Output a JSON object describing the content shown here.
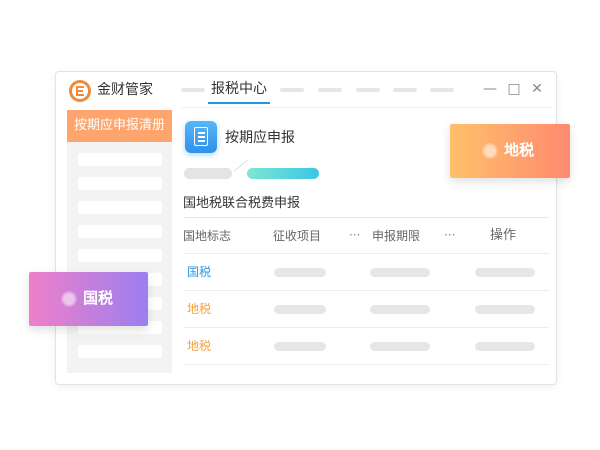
{
  "window": {
    "app_title": "金财管家",
    "active_tab": "报税中心",
    "controls": {
      "minimize": "—",
      "maximize": "□",
      "close": "✕"
    }
  },
  "sidebar": {
    "header_label": "按期应申报清册",
    "header_color": "#fda56c"
  },
  "main": {
    "section_title": "按期应申报",
    "section_icon": "document-icon",
    "table_title": "国地税联合税费申报",
    "columns": [
      "国地标志",
      "征收项目",
      "···",
      "申报期限",
      "···",
      "操作"
    ],
    "rows": [
      {
        "tag": "国税",
        "tag_color": "#2a9be3"
      },
      {
        "tag": "地税",
        "tag_color": "#f2a23c"
      },
      {
        "tag": "地税",
        "tag_color": "#f2a23c"
      }
    ]
  },
  "badges": {
    "local": {
      "label": "地税",
      "gradient": [
        "#ffc06a",
        "#ff8a6e"
      ]
    },
    "national": {
      "label": "国税",
      "gradient": [
        "#ef7fc9",
        "#9b7ff0"
      ]
    }
  }
}
